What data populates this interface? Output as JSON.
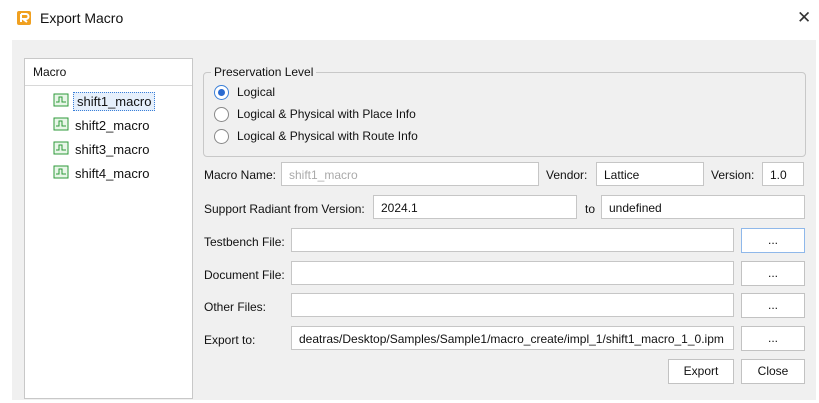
{
  "window": {
    "title": "Export Macro",
    "close_symbol": "✕"
  },
  "macro_panel": {
    "header": "Macro",
    "items": [
      {
        "label": "shift1_macro",
        "selected": true
      },
      {
        "label": "shift2_macro",
        "selected": false
      },
      {
        "label": "shift3_macro",
        "selected": false
      },
      {
        "label": "shift4_macro",
        "selected": false
      }
    ]
  },
  "preservation": {
    "legend": "Preservation Level",
    "options": [
      {
        "label": "Logical",
        "checked": true
      },
      {
        "label": "Logical & Physical with Place Info",
        "checked": false
      },
      {
        "label": "Logical & Physical with Route Info",
        "checked": false
      }
    ]
  },
  "form": {
    "macro_name_label": "Macro Name:",
    "macro_name_placeholder": "shift1_macro",
    "vendor_label": "Vendor:",
    "vendor_value": "Lattice",
    "version_label": "Version:",
    "version_value": "1.0",
    "support_label": "Support Radiant from Version:",
    "support_from": "2024.1",
    "to_label": "to",
    "support_to": "undefined",
    "testbench_label": "Testbench File:",
    "testbench_value": "",
    "document_label": "Document File:",
    "document_value": "",
    "other_label": "Other Files:",
    "other_value": "",
    "export_to_label": "Export to:",
    "export_to_value": "deatras/Desktop/Samples/Sample1/macro_create/impl_1/shift1_macro_1_0.ipm",
    "browse_label": "..."
  },
  "buttons": {
    "export": "Export",
    "close": "Close"
  },
  "colors": {
    "accent": "#2a6ad0",
    "app_icon": "#f0a020",
    "macro_icon": "#2e9a3a"
  }
}
